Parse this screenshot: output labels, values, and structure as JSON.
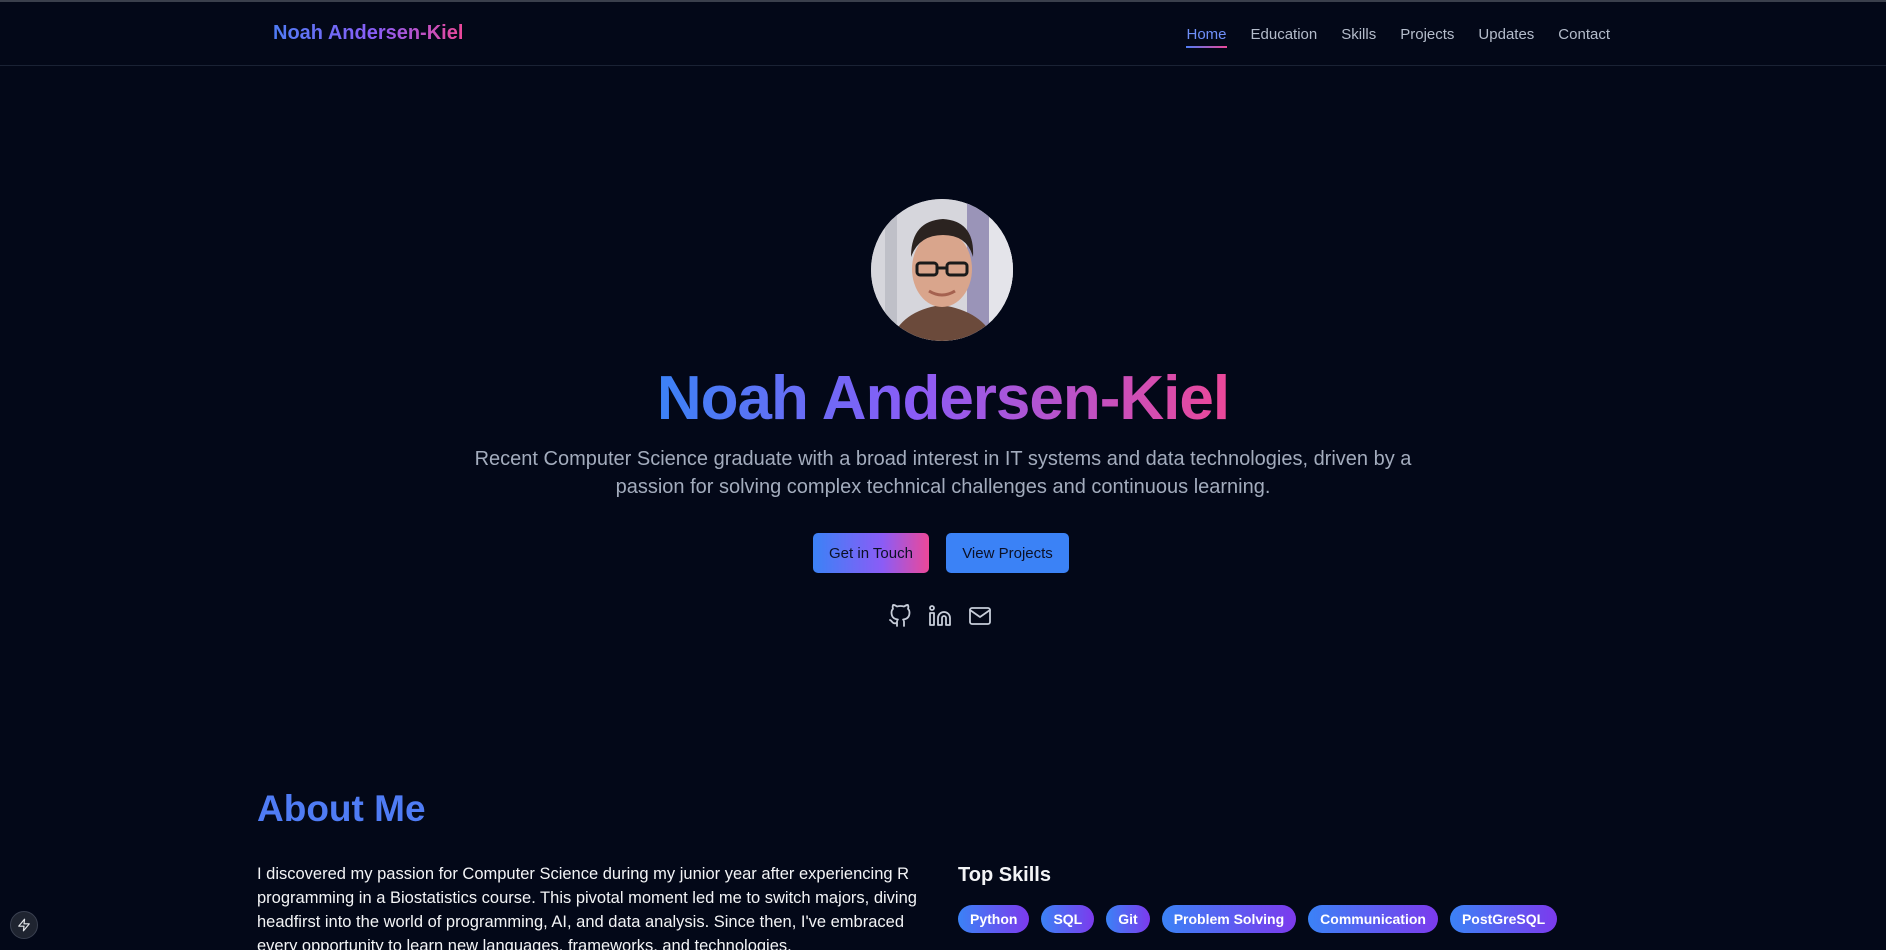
{
  "header": {
    "brand": "Noah Andersen-Kiel",
    "nav": [
      {
        "label": "Home",
        "active": true
      },
      {
        "label": "Education"
      },
      {
        "label": "Skills"
      },
      {
        "label": "Projects"
      },
      {
        "label": "Updates"
      },
      {
        "label": "Contact"
      }
    ]
  },
  "hero": {
    "name": "Noah Andersen-Kiel",
    "tagline": "Recent Computer Science graduate with a broad interest in IT systems and data technologies, driven by a passion for solving complex technical challenges and continuous learning.",
    "primary_button": "Get in Touch",
    "secondary_button": "View Projects",
    "socials": [
      "github-icon",
      "linkedin-icon",
      "mail-icon"
    ]
  },
  "about": {
    "title": "About Me",
    "text": "I discovered my passion for Computer Science during my junior year after experiencing R programming in a Biostatistics course. This pivotal moment led me to switch majors, diving headfirst into the world of programming, AI, and data analysis. Since then, I've embraced every opportunity to learn new languages, frameworks, and technologies.",
    "skills_title": "Top Skills",
    "skills": [
      "Python",
      "SQL",
      "Git",
      "Problem Solving",
      "Communication",
      "PostGreSQL"
    ]
  },
  "colors": {
    "background": "#030818",
    "accent_blue": "#3b82f6",
    "accent_purple": "#8b5cf6",
    "accent_pink": "#ec4899"
  }
}
